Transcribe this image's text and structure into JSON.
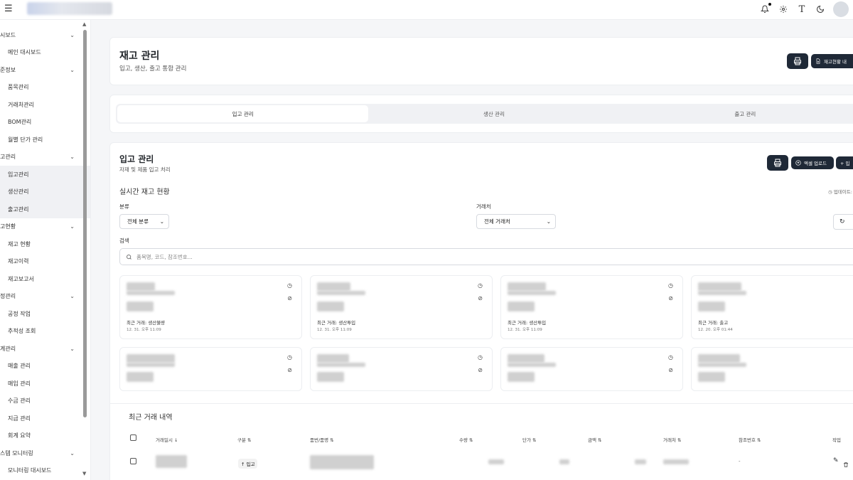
{
  "topbar": {
    "menu_icon": "menu-icon",
    "icons": [
      "bell-icon",
      "gear-icon",
      "text-icon",
      "moon-icon"
    ]
  },
  "sidebar": {
    "items": [
      {
        "type": "section",
        "label": "시보드"
      },
      {
        "type": "item",
        "label": "메인 대시보드"
      },
      {
        "type": "section",
        "label": "준정보"
      },
      {
        "type": "item",
        "label": "품목관리"
      },
      {
        "type": "item",
        "label": "거래처관리"
      },
      {
        "type": "item",
        "label": "BOM관리"
      },
      {
        "type": "item",
        "label": "월별 단가 관리"
      },
      {
        "type": "section",
        "label": "고관리"
      },
      {
        "type": "item",
        "label": "입고관리",
        "active": true
      },
      {
        "type": "item",
        "label": "생산관리",
        "active": true
      },
      {
        "type": "item",
        "label": "출고관리",
        "active": true
      },
      {
        "type": "section",
        "label": "고현황"
      },
      {
        "type": "item",
        "label": "재고 현황"
      },
      {
        "type": "item",
        "label": "재고이력"
      },
      {
        "type": "item",
        "label": "재고보고서"
      },
      {
        "type": "section",
        "label": "정관리"
      },
      {
        "type": "item",
        "label": "공정 작업"
      },
      {
        "type": "item",
        "label": "추적성 조회"
      },
      {
        "type": "section",
        "label": "계관리"
      },
      {
        "type": "item",
        "label": "매출 관리"
      },
      {
        "type": "item",
        "label": "매입 관리"
      },
      {
        "type": "item",
        "label": "수금 관리"
      },
      {
        "type": "item",
        "label": "지급 관리"
      },
      {
        "type": "item",
        "label": "회계 요약"
      },
      {
        "type": "section",
        "label": "스템 모니터링"
      },
      {
        "type": "item",
        "label": "모니터링 대시보드"
      }
    ]
  },
  "header": {
    "title": "재고 관리",
    "subtitle": "입고, 생산, 출고 통합 관리",
    "report_button": "재고현황 내"
  },
  "tabs": [
    {
      "label": "입고 관리",
      "active": true
    },
    {
      "label": "생산 관리"
    },
    {
      "label": "출고 관리"
    }
  ],
  "section": {
    "title": "입고 관리",
    "subtitle": "자재 및 제품 입고 처리",
    "excel_button": "엑셀 업로드",
    "add_button": "+ 입",
    "realtime_title": "실시간 재고 현황",
    "updated_label": "업데이트: 오후",
    "category_label": "분류",
    "category_value": "전체 분류",
    "vendor_label": "거래처",
    "vendor_value": "전체 거래처",
    "search_label": "검색",
    "search_placeholder": "품목명, 코드, 참조번호..."
  },
  "inventory_cards": [
    {
      "last": "최근 거래: 생산불량",
      "date": "12. 31. 오후 11:09"
    },
    {
      "last": "최근 거래: 생산투입",
      "date": "12. 31. 오후 11:09"
    },
    {
      "last": "최근 거래: 생산투입",
      "date": "12. 31. 오후 11:09"
    },
    {
      "last": "최근 거래: 출고",
      "date": "12. 20. 오후 01:44"
    },
    {
      "last": "",
      "date": ""
    },
    {
      "last": "",
      "date": ""
    },
    {
      "last": "",
      "date": ""
    },
    {
      "last": "",
      "date": ""
    }
  ],
  "table": {
    "title": "최근 거래 내역",
    "columns": [
      "거래일시 ↓",
      "구분 ⇅",
      "품번/품명 ⇅",
      "수량 ⇅",
      "단가 ⇅",
      "금액 ⇅",
      "거래처 ⇅",
      "참조번호 ⇅",
      "작업"
    ],
    "rows": [
      {
        "type": "↑ 입고",
        "ref": "-"
      }
    ]
  }
}
